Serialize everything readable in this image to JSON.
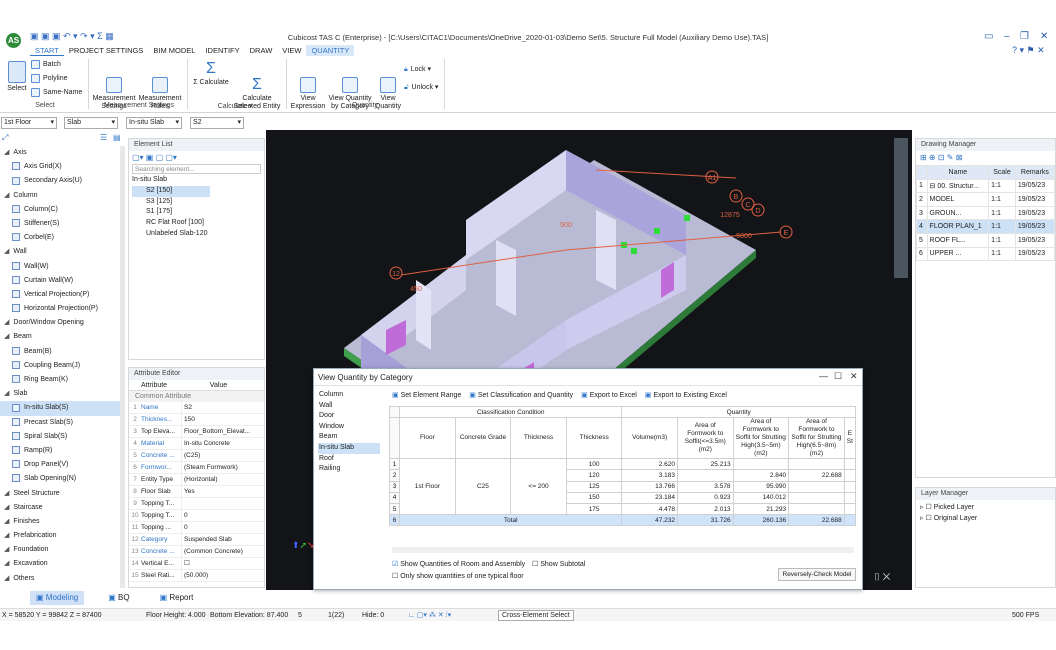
{
  "window": {
    "title": "Cubicost TAS C (Enterprise) - [C:\\Users\\CITAC1\\Documents\\OneDrive_2020-01-03\\Demo Set\\5. Structure Full Model (Auxiliary Demo Use).TAS]",
    "logo_text": "AS"
  },
  "ribbon_tabs": [
    "START",
    "PROJECT SETTINGS",
    "BIM MODEL",
    "IDENTIFY",
    "DRAW",
    "VIEW",
    "QUANTITY"
  ],
  "ribbon": {
    "select": {
      "label": "Select",
      "group": "Select",
      "options": [
        "Batch",
        "Polyline",
        "Same-Name"
      ]
    },
    "measurement": {
      "settings": "Measurement\nSettings",
      "rules": "Measurement\nRules",
      "group": "Measurement Settings"
    },
    "calculate": {
      "calc": "Σ Calculate",
      "calc_selected": "Calculate\nSelected Entity",
      "group": "Calculate ▾"
    },
    "quantity": {
      "view_expression": "View\nExpression",
      "view_by_category": "View Quantity\nby Category",
      "view_quantity": "View\nQuantity",
      "lock": "Lock ▾",
      "unlock": "Unlock ▾",
      "group": "Quantity"
    }
  },
  "filters": {
    "floor": "1st Floor",
    "type": "Slab",
    "subtype": "In-situ Slab",
    "name": "S2"
  },
  "tree": [
    {
      "label": "Axis",
      "level": 0,
      "icon": "arrow-icon"
    },
    {
      "label": "Axis Grid(X)",
      "level": 1,
      "icon": "grid-icon"
    },
    {
      "label": "Secondary Axis(U)",
      "level": 1,
      "icon": "axis-icon"
    },
    {
      "label": "Column",
      "level": 0,
      "icon": "arrow-icon"
    },
    {
      "label": "Column(C)",
      "level": 1,
      "icon": "column-icon"
    },
    {
      "label": "Stiffener(S)",
      "level": 1,
      "icon": "stiffener-icon"
    },
    {
      "label": "Corbel(E)",
      "level": 1,
      "icon": "corbel-icon"
    },
    {
      "label": "Wall",
      "level": 0,
      "icon": "arrow-icon"
    },
    {
      "label": "Wall(W)",
      "level": 1,
      "icon": "wall-icon"
    },
    {
      "label": "Curtain Wall(W)",
      "level": 1,
      "icon": "curtain-wall-icon"
    },
    {
      "label": "Vertical Projection(P)",
      "level": 1,
      "icon": "projection-icon"
    },
    {
      "label": "Horizontal Projection(P)",
      "level": 1,
      "icon": "projection-icon"
    },
    {
      "label": "Door/Window Opening",
      "level": 0,
      "icon": "arrow-icon"
    },
    {
      "label": "Beam",
      "level": 0,
      "icon": "arrow-icon"
    },
    {
      "label": "Beam(B)",
      "level": 1,
      "icon": "beam-icon"
    },
    {
      "label": "Coupling Beam(J)",
      "level": 1,
      "icon": "beam-icon"
    },
    {
      "label": "Ring Beam(K)",
      "level": 1,
      "icon": "beam-icon"
    },
    {
      "label": "Slab",
      "level": 0,
      "icon": "arrow-icon"
    },
    {
      "label": "In-situ Slab(S)",
      "level": 1,
      "icon": "slab-icon",
      "selected": true
    },
    {
      "label": "Precast Slab(S)",
      "level": 1,
      "icon": "slab-icon"
    },
    {
      "label": "Spiral Slab(S)",
      "level": 1,
      "icon": "spiral-icon"
    },
    {
      "label": "Ramp(R)",
      "level": 1,
      "icon": "ramp-icon"
    },
    {
      "label": "Drop Panel(V)",
      "level": 1,
      "icon": "drop-panel-icon"
    },
    {
      "label": "Slab Opening(N)",
      "level": 1,
      "icon": "opening-icon"
    },
    {
      "label": "Steel Structure",
      "level": 0,
      "icon": "arrow-icon"
    },
    {
      "label": "Staircase",
      "level": 0,
      "icon": "arrow-icon"
    },
    {
      "label": "Finishes",
      "level": 0,
      "icon": "arrow-icon"
    },
    {
      "label": "Prefabrication",
      "level": 0,
      "icon": "arrow-icon"
    },
    {
      "label": "Foundation",
      "level": 0,
      "icon": "arrow-icon"
    },
    {
      "label": "Excavation",
      "level": 0,
      "icon": "arrow-icon"
    },
    {
      "label": "Others",
      "level": 0,
      "icon": "arrow-icon"
    }
  ],
  "element_list": {
    "title": "Element List",
    "search_placeholder": "Searching element...",
    "group": "In-situ Slab",
    "items": [
      "S2 [150]",
      "S3 [125]",
      "S1 [175]",
      "RC Flat Roof [100]",
      "Unlabeled Slab-120"
    ]
  },
  "attribute_editor": {
    "title": "Attribute Editor",
    "col_attr": "Attribute",
    "col_value": "Value",
    "section": "Common Attribute",
    "rows": [
      {
        "n": "1",
        "k": "Name",
        "v": "S2",
        "blue": true
      },
      {
        "n": "2",
        "k": "Thicknes...",
        "v": "150",
        "blue": true
      },
      {
        "n": "3",
        "k": "Top Eleva...",
        "v": "Floor_Bottom_Elevat..."
      },
      {
        "n": "4",
        "k": "Material",
        "v": "In-situ Concrete",
        "blue": true
      },
      {
        "n": "5",
        "k": "Concrete ...",
        "v": "(C25)",
        "blue": true
      },
      {
        "n": "6",
        "k": "Formwor...",
        "v": "(Steam Formwork)",
        "blue": true
      },
      {
        "n": "7",
        "k": "Entity Type",
        "v": "(Horizontal)"
      },
      {
        "n": "8",
        "k": "Floor Slab",
        "v": "Yes"
      },
      {
        "n": "9",
        "k": "Topping T...",
        "v": ""
      },
      {
        "n": "10",
        "k": "Topping T...",
        "v": "0"
      },
      {
        "n": "11",
        "k": "Topping ...",
        "v": "0"
      },
      {
        "n": "12",
        "k": "Category",
        "v": "Suspended Slab",
        "blue": true
      },
      {
        "n": "13",
        "k": "Concrete ...",
        "v": "(Common Concrete)",
        "blue": true
      },
      {
        "n": "14",
        "k": "Vertical E...",
        "v": "☐"
      },
      {
        "n": "15",
        "k": "Steel Rati...",
        "v": "(50.000)"
      }
    ]
  },
  "viewport": {
    "axis_labels": [
      "A1",
      "B",
      "C",
      "D",
      "E",
      "12",
      "450",
      "12875",
      "5000",
      "500"
    ]
  },
  "drawing_manager": {
    "title": "Drawing Manager",
    "headers": [
      "",
      "Name",
      "Scale",
      "Remarks"
    ],
    "rows": [
      {
        "n": "1",
        "name": "⊟ 00. Structur...",
        "scale": "1:1",
        "remarks": "19/05/23"
      },
      {
        "n": "2",
        "name": "MODEL",
        "scale": "1:1",
        "remarks": "19/05/23"
      },
      {
        "n": "3",
        "name": "GROUN...",
        "scale": "1:1",
        "remarks": "19/05/23"
      },
      {
        "n": "4",
        "name": "FLOOR PLAN_1",
        "scale": "1:1",
        "remarks": "19/05/23",
        "active": true
      },
      {
        "n": "5",
        "name": "ROOF FL...",
        "scale": "1:1",
        "remarks": "19/05/23"
      },
      {
        "n": "6",
        "name": "UPPER ...",
        "scale": "1:1",
        "remarks": "19/05/23"
      }
    ]
  },
  "layer_manager": {
    "title": "Layer Manager",
    "items": [
      "Picked Layer",
      "Original Layer"
    ]
  },
  "dialog": {
    "title": "View Quantity by Category",
    "categories": [
      "Column",
      "Wall",
      "Door",
      "Window",
      "Beam",
      "In-situ Slab",
      "Roof",
      "Railing"
    ],
    "toolbar": [
      "Set Element Range",
      "Set Classification and Quantity",
      "Export to Excel",
      "Export to Existing Excel"
    ],
    "group_headers": {
      "classification": "Classification Condition",
      "quantity": "Quantity"
    },
    "headers": [
      "Floor",
      "Concrete Grade",
      "Thickness",
      "Thickness",
      "Volume(m3)",
      "Area of Formwork to Soffit(<=3.5m)(m2)",
      "Area of Formwork to Soffit for Strutting High(3.5~5m)(m2)",
      "Area of Formwork to Soffit for Strutting High(6.5~8m)(m2)",
      "E St"
    ],
    "floor": "1st Floor",
    "grade": "C25",
    "thick_cond": "<= 200",
    "rows": [
      {
        "n": "1",
        "t": "100",
        "v": "2.620",
        "a1": "25.213",
        "a2": "",
        "a3": ""
      },
      {
        "n": "2",
        "t": "120",
        "v": "3.183",
        "a1": "",
        "a2": "2.840",
        "a3": "22.688"
      },
      {
        "n": "3",
        "t": "125",
        "v": "13.766",
        "a1": "3.578",
        "a2": "95.990",
        "a3": ""
      },
      {
        "n": "4",
        "t": "150",
        "v": "23.184",
        "a1": "0.923",
        "a2": "140.012",
        "a3": ""
      },
      {
        "n": "5",
        "t": "175",
        "v": "4.478",
        "a1": "2.013",
        "a2": "21.293",
        "a3": ""
      }
    ],
    "total": {
      "n": "6",
      "label": "Total",
      "v": "47.232",
      "a1": "31.726",
      "a2": "260.136",
      "a3": "22.688"
    },
    "opt1": "Show Quantities of Room and Assembly",
    "opt2": "Show Subtotal",
    "opt3": "Only show quantities of one typical floor",
    "check_btn": "Reversely-Check Model"
  },
  "bottom_tabs": [
    "Modeling",
    "BQ",
    "Report"
  ],
  "status": {
    "coords": "X = 58520 Y = 99842 Z = 87400",
    "floor_height": "Floor Height: 4.000",
    "bottom_elev": "Bottom Elevation: 87.400",
    "n1": "5",
    "n2": "1(22)",
    "hide": "Hide: 0",
    "cross": "Cross-Element Select",
    "fps": "500 FPS"
  },
  "colors": {
    "accent": "#2f75c8",
    "viewport": "#121418",
    "slab": "#c9cde8",
    "wall": "#b9b2e6",
    "highlight": "#2edc3a",
    "axis": "#e06040"
  }
}
